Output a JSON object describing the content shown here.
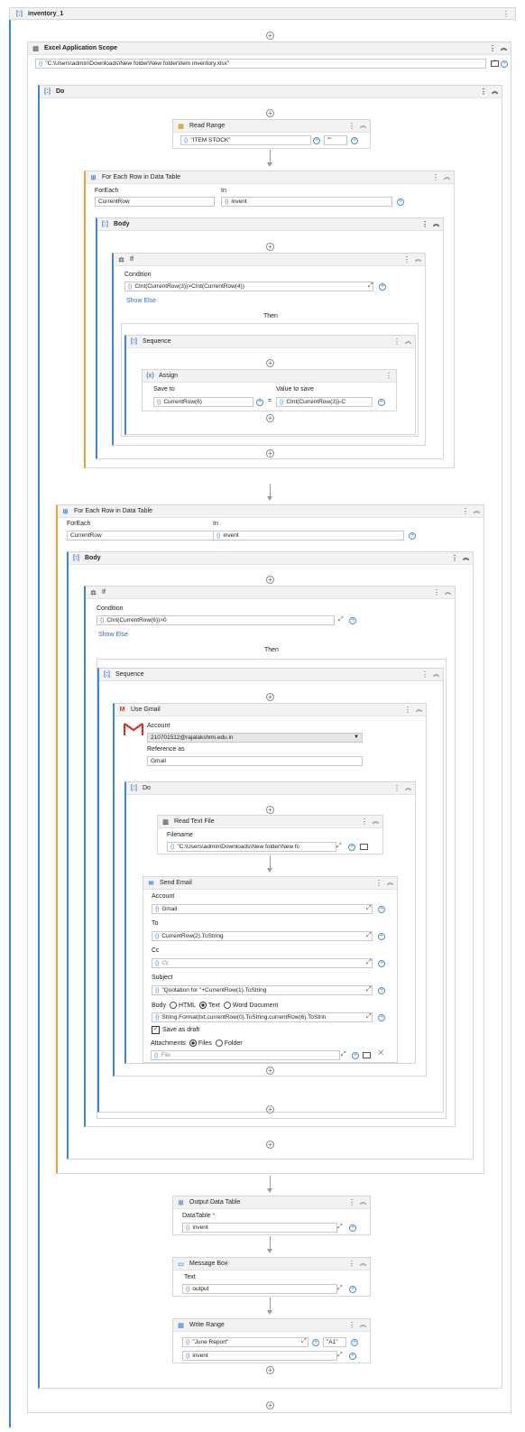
{
  "title": "inventory_1",
  "excel_scope": {
    "title": "Excel Application Scope",
    "path": "\"C:\\Users\\admin\\Downloads\\New folder\\New folder\\item inventory.xlsx\""
  },
  "do_label": "Do",
  "read_range": {
    "title": "Read Range",
    "sheet": "\"ITEM STOCK\"",
    "range": "\"\""
  },
  "foreach1": {
    "title": "For Each Row in Data Table",
    "foreach_label": "ForEach",
    "foreach_value": "CurrentRow",
    "in_label": "In",
    "in_value": "invent"
  },
  "body_label": "Body",
  "if1": {
    "title": "If",
    "condition_label": "Condition",
    "condition": "CInt(CurrentRow(3))>CInt(CurrentRow(4))",
    "show_else": "Show Else",
    "then": "Then"
  },
  "sequence_label": "Sequence",
  "assign": {
    "title": "Assign",
    "save_to_label": "Save to",
    "save_to": "CurrentRow(6)",
    "value_label": "Value to save",
    "value": "CInt(CurrentRow(3))-C",
    "equals": "="
  },
  "foreach2": {
    "title": "For Each Row in Data Table",
    "foreach_label": "ForEach",
    "foreach_value": "CurrentRow",
    "in_label": "In",
    "in_value": "invent"
  },
  "if2": {
    "title": "If",
    "condition_label": "Condition",
    "condition": "CInt(CurrentRow(6))>0",
    "show_else": "Show Else",
    "then": "Then"
  },
  "gmail": {
    "title": "Use Gmail",
    "account_label": "Account",
    "account": "210701512@rajalakshmi.edu.in",
    "reference_label": "Reference as",
    "reference": "Gmail"
  },
  "read_text": {
    "title": "Read Text File",
    "filename_label": "Filename",
    "filename": "\"C:\\Users\\admin\\Downloads\\New folder\\New fc"
  },
  "send_email": {
    "title": "Send Email",
    "account_label": "Account",
    "account": "Gmail",
    "to_label": "To",
    "to": "CurrentRow(2).ToString",
    "cc_label": "Cc",
    "cc_placeholder": "Cc",
    "subject_label": "Subject",
    "subject": "\"Quotation for \"+CurrentRow(1).ToString",
    "body_label": "Body",
    "body_options": [
      "HTML",
      "Text",
      "Word Document"
    ],
    "body_selected": "Text",
    "body_value": "String.Format(txt,currentRow(0).ToString,currentRow(6).ToStrin",
    "save_draft": "Save as draft",
    "attachments_label": "Attachments",
    "attach_options": [
      "Files",
      "Folder"
    ],
    "attach_selected": "Files",
    "file_placeholder": "File"
  },
  "output_dt": {
    "title": "Output Data Table",
    "datatable_label": "DataTable",
    "required": "*",
    "value": "invent"
  },
  "message_box": {
    "title": "Message Box",
    "text_label": "Text",
    "value": "output"
  },
  "write_range": {
    "title": "Write Range",
    "sheet": "\"June Report\"",
    "cell": "\"A1\"",
    "value": "invent"
  },
  "colors": {
    "accent": "#3d87d6",
    "foreach_accent": "#e8a33b",
    "gmail_red": "#d93025"
  }
}
